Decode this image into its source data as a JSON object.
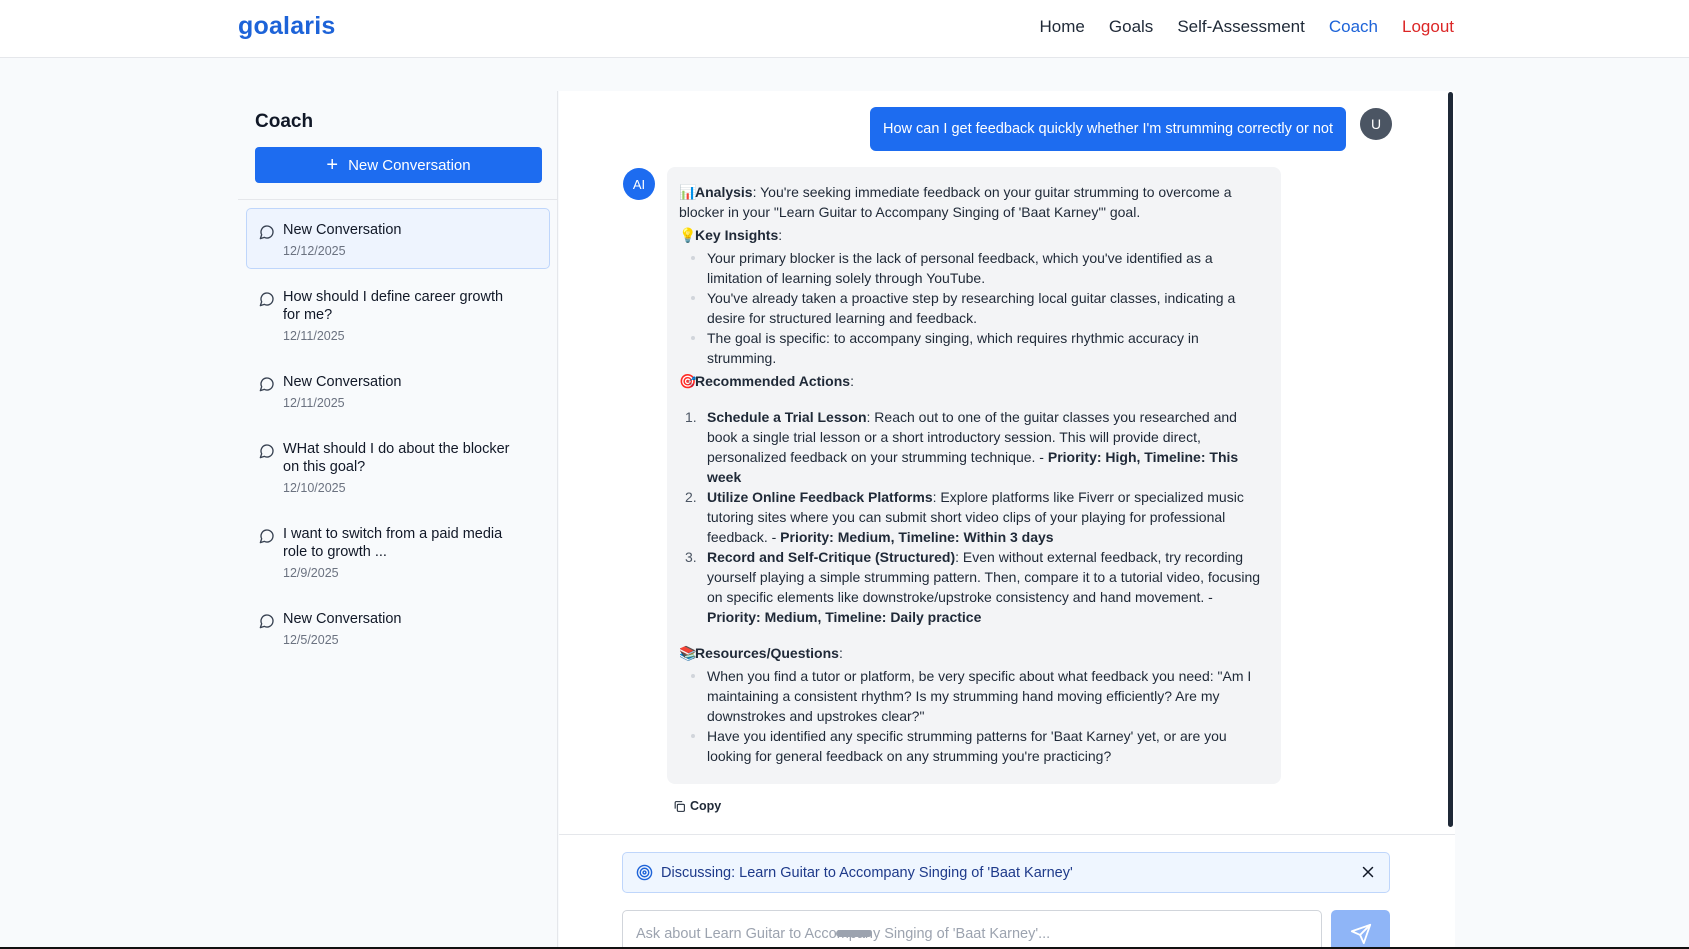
{
  "nav": {
    "brand": "goalaris",
    "links": [
      {
        "label": "Home"
      },
      {
        "label": "Goals"
      },
      {
        "label": "Self-Assessment"
      },
      {
        "label": "Coach"
      },
      {
        "label": "Logout"
      }
    ],
    "active": "Coach",
    "accent_color": "#1d63d8",
    "logout_color": "#dc2626"
  },
  "sidebar": {
    "title": "Coach",
    "new_button_label": "New Conversation",
    "conversations": [
      {
        "title": "New Conversation",
        "date": "12/12/2025"
      },
      {
        "title": "How should I define career growth for me?",
        "date": "12/11/2025"
      },
      {
        "title": "New Conversation",
        "date": "12/11/2025"
      },
      {
        "title": "WHat should I do about the blocker on this goal?",
        "date": "12/10/2025"
      },
      {
        "title": "I want to switch from a paid media role to growth ...",
        "date": "12/9/2025"
      },
      {
        "title": "New Conversation",
        "date": "12/5/2025"
      }
    ]
  },
  "chat": {
    "user_message": "How can I get feedback quickly whether I'm strumming correctly or not",
    "user_avatar": "U",
    "ai_avatar": "AI",
    "reply": {
      "analysis_label": "Analysis",
      "analysis_text": ": You're seeking immediate feedback on your guitar strumming to overcome a blocker in your \"Learn Guitar to Accompany Singing of 'Baat Karney'\" goal.",
      "insights_label": "Key Insights",
      "insights": [
        "Your primary blocker is the lack of personal feedback, which you've identified as a limitation of learning solely through YouTube.",
        "You've already taken a proactive step by researching local guitar classes, indicating a desire for structured learning and feedback.",
        "The goal is specific: to accompany singing, which requires rhythmic accuracy in strumming."
      ],
      "actions_label": "Recommended Actions",
      "actions": [
        {
          "num": "1.",
          "title": "Schedule a Trial Lesson",
          "text": ": Reach out to one of the guitar classes you researched and book a single trial lesson or a short introductory session. This will provide direct, personalized feedback on your strumming technique. - ",
          "priority": "Priority: High, Timeline: This week"
        },
        {
          "num": "2.",
          "title": "Utilize Online Feedback Platforms",
          "text": ": Explore platforms like Fiverr or specialized music tutoring sites where you can submit short video clips of your playing for professional feedback. - ",
          "priority": "Priority: Medium, Timeline: Within 3 days"
        },
        {
          "num": "3.",
          "title": "Record and Self-Critique (Structured)",
          "text": ": Even without external feedback, try recording yourself playing a simple strumming pattern. Then, compare it to a tutorial video, focusing on specific elements like downstroke/upstroke consistency and hand movement. - ",
          "priority": "Priority: Medium, Timeline: Daily practice"
        }
      ],
      "resources_label": "Resources/Questions",
      "resources": [
        "When you find a tutor or platform, be very specific about what feedback you need: \"Am I maintaining a consistent rhythm? Is my strumming hand moving efficiently? Are my downstrokes and upstrokes clear?\"",
        "Have you identified any specific strumming patterns for 'Baat Karney' yet, or are you looking for general feedback on any strumming you're practicing?"
      ],
      "emoji": {
        "analysis": "📊",
        "insights": "💡",
        "actions": "🎯",
        "resources": "📚"
      }
    },
    "copy_label": "Copy",
    "context_text": "Discussing: Learn Guitar to Accompany Singing of 'Baat Karney'",
    "input_placeholder": "Ask about Learn Guitar to Accompany Singing of 'Baat Karney'...",
    "input_value": ""
  }
}
